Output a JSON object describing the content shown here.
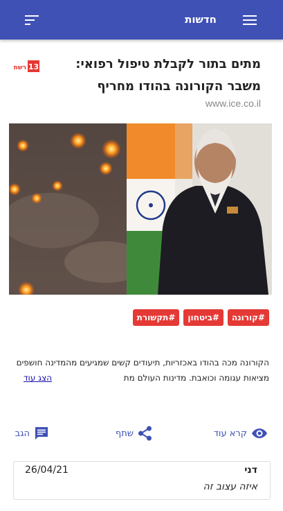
{
  "header": {
    "title": "חדשות",
    "menu_icon": "hamburger-menu-icon",
    "filter_icon": "sort-filter-icon",
    "background_color": "#3f51b5"
  },
  "article": {
    "headline": "מתים בתור לקבלת טיפול רפואי: משבר הקורונה בהודו מחריף",
    "source": "www.ice.co.il",
    "logo_text": "13 רשת",
    "tags": [
      "#קורונה",
      "#ביטחון",
      "#תקשורת"
    ],
    "excerpt": "הקורונה מכה בהודו באכזריות, תיעודים קשים שמגיעים מהמדינה חושפים מציאות עגומה וכואבת. מדינות העולם מת",
    "show_more_label": "הצג עוד",
    "tag_color": "#e53935"
  },
  "actions": {
    "read_more_label": "קרא עוד",
    "share_label": "שתף",
    "respond_label": "הגב",
    "read_more_icon": "eye-icon",
    "share_icon": "share-icon",
    "respond_icon": "comment-icon"
  },
  "comment": {
    "author": "דני",
    "date": "26/04/21",
    "text": "איזה עצוב זה"
  }
}
